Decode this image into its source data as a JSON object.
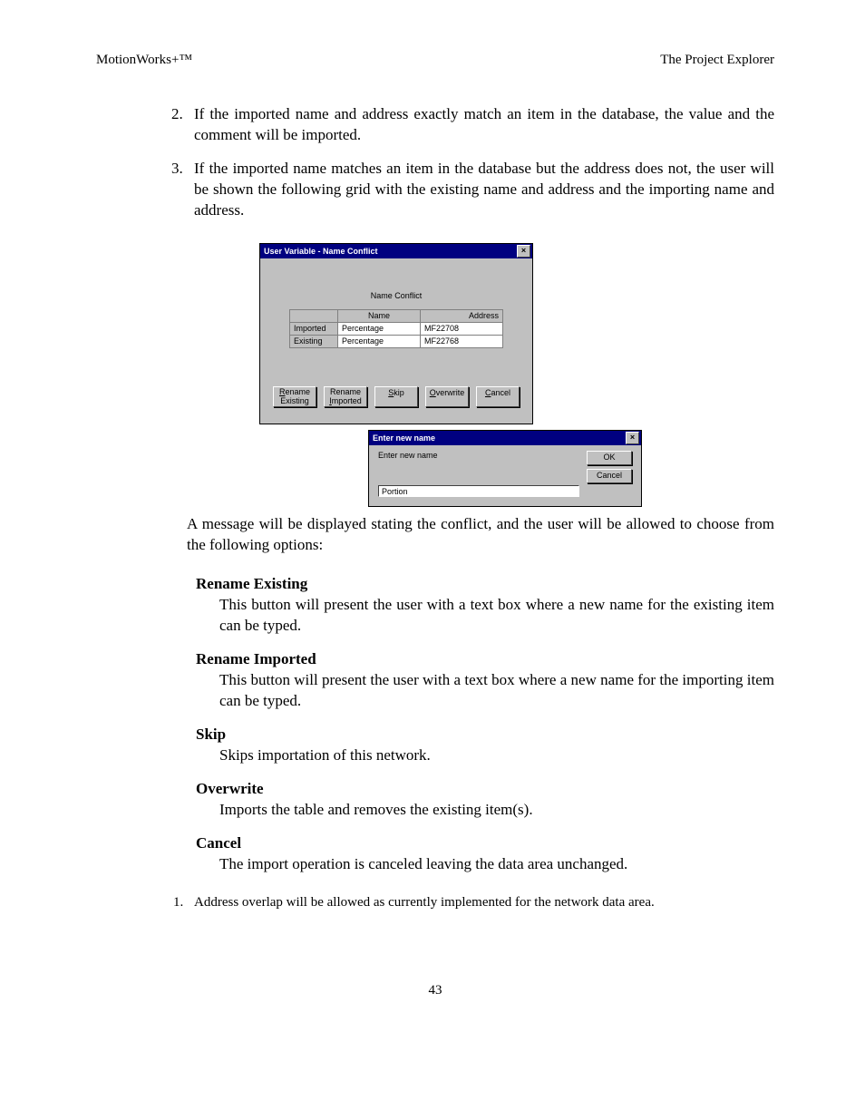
{
  "header": {
    "left": "MotionWorks+™",
    "right": "The Project Explorer"
  },
  "list_main": {
    "item2": "If the imported name and address exactly match an item in the database, the value and the comment will be imported.",
    "item3": "If the imported name matches an item in the database but the address does not, the user will be shown the following grid with the existing name and address and the importing name and address."
  },
  "dialog1": {
    "title": "User Variable - Name Conflict",
    "heading": "Name Conflict",
    "columns": {
      "name": "Name",
      "address": "Address"
    },
    "rows": [
      {
        "label": "Imported",
        "name": "Percentage",
        "address": "MF22708"
      },
      {
        "label": "Existing",
        "name": "Percentage",
        "address": "MF22768"
      }
    ],
    "buttons": {
      "rename_existing_l1": "Rename",
      "rename_existing_l2": "Existing",
      "rename_imported_l1": "Rename",
      "rename_imported_l2": "Imported",
      "skip": "Skip",
      "overwrite": "Overwrite",
      "cancel": "Cancel"
    }
  },
  "dialog2": {
    "title": "Enter new name",
    "label": "Enter new name",
    "value": "Portion",
    "ok": "OK",
    "cancel": "Cancel"
  },
  "after_dialog": "A message will be displayed stating the conflict, and the user will be allowed to choose from the following options:",
  "options": {
    "rename_existing": {
      "title": "Rename Existing",
      "body": "This button will present the user with a text box where a new name for the existing item can be typed."
    },
    "rename_imported": {
      "title": "Rename Imported",
      "body": "This button will present the user with a text box where a new name for the importing item can be typed."
    },
    "skip": {
      "title": "Skip",
      "body": "Skips importation of this network."
    },
    "overwrite": {
      "title": "Overwrite",
      "body": "Imports the table and removes the existing item(s)."
    },
    "cancel": {
      "title": "Cancel",
      "body": "The import operation is canceled leaving the data area unchanged."
    }
  },
  "footer_note": "Address overlap will be allowed as currently implemented for the network data area.",
  "page_number": "43"
}
